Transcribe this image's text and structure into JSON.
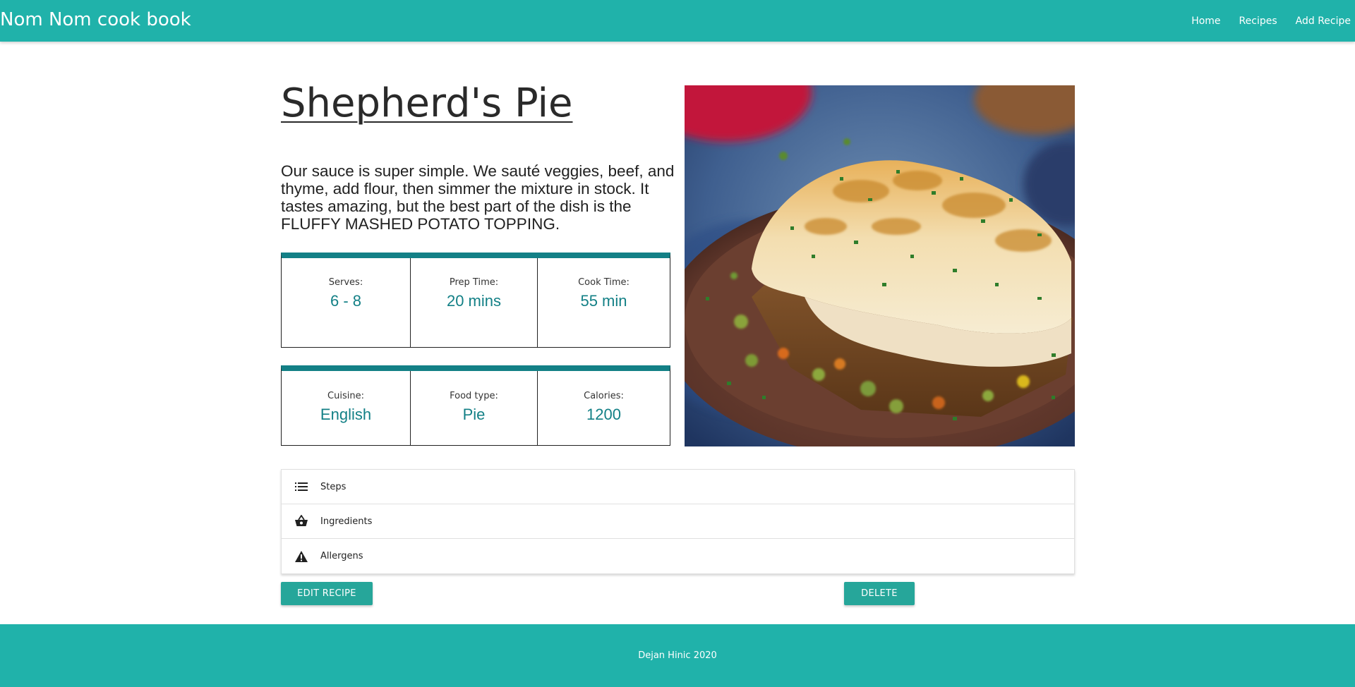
{
  "navbar": {
    "brand": "Nom Nom cook book",
    "links": [
      "Home",
      "Recipes",
      "Add Recipe"
    ]
  },
  "recipe": {
    "title": "Shepherd's Pie",
    "description": "Our sauce is super simple. We sauté veggies, beef, and thyme, add flour, then simmer the mixture in stock. It tastes amazing, but the best part of the dish is the FLUFFY MASHED POTATO TOPPING.",
    "info_top": [
      {
        "label": "Serves:",
        "value": "6 - 8"
      },
      {
        "label": "Prep Time:",
        "value": "20 mins"
      },
      {
        "label": "Cook Time:",
        "value": "55 min"
      }
    ],
    "info_bottom": [
      {
        "label": "Cuisine:",
        "value": "English"
      },
      {
        "label": "Food type:",
        "value": "Pie"
      },
      {
        "label": "Calories:",
        "value": "1200"
      }
    ],
    "image_icon": "shepherds-pie-photo"
  },
  "sections": [
    {
      "label": "Steps",
      "icon": "list-icon"
    },
    {
      "label": "Ingredients",
      "icon": "basket-icon"
    },
    {
      "label": "Allergens",
      "icon": "warning-icon"
    }
  ],
  "actions": {
    "edit_label": "EDIT RECIPE",
    "delete_label": "DELETE"
  },
  "footer": {
    "text": "Dejan Hinic 2020"
  },
  "colors": {
    "primary": "#20b2aa",
    "accent": "#138086",
    "button": "#26a69a"
  }
}
